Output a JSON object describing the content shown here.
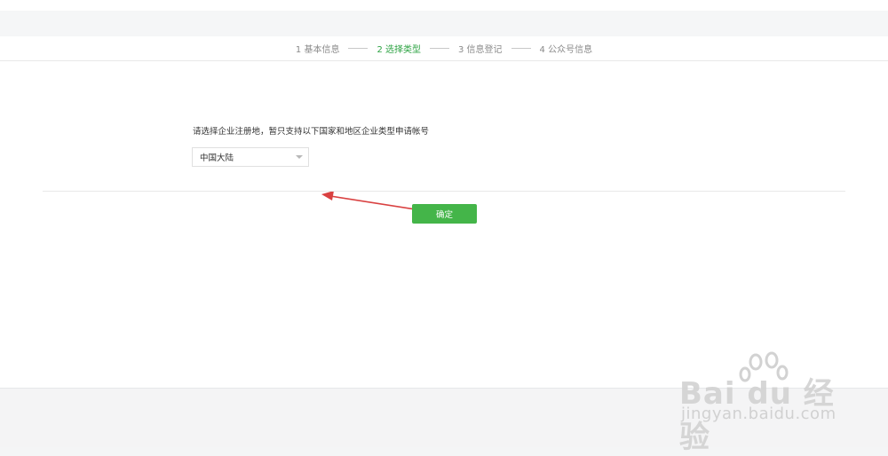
{
  "steps": [
    {
      "label": "1 基本信息",
      "active": false
    },
    {
      "label": "2 选择类型",
      "active": true
    },
    {
      "label": "3 信息登记",
      "active": false
    },
    {
      "label": "4 公众号信息",
      "active": false
    }
  ],
  "form": {
    "prompt": "请选择企业注册地，暂只支持以下国家和地区企业类型申请帐号",
    "region_select": {
      "selected": "中国大陆"
    },
    "confirm_label": "确定"
  },
  "watermark": {
    "brand": "Bai du 经验",
    "url": "jingyan.baidu.com"
  },
  "colors": {
    "accent": "#44b549",
    "active_step": "#2da343",
    "annotation_arrow": "#d94141"
  }
}
